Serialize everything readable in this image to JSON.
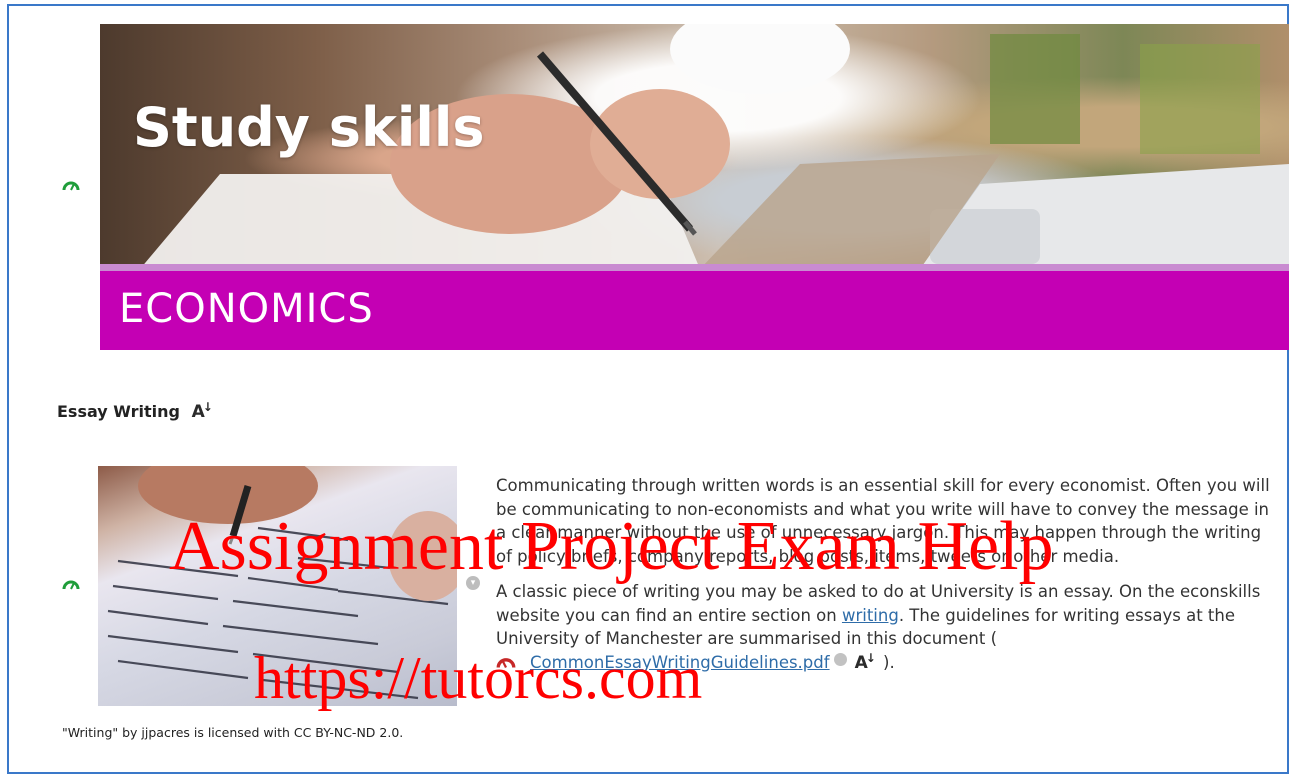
{
  "banner": {
    "title": "Study skills",
    "subtitle": "ECONOMICS"
  },
  "section": {
    "heading": "Essay Writing",
    "accessibility_icon_glyph": "A"
  },
  "image": {
    "caption": "\"Writing\" by jjpacres is licensed with CC BY-NC-ND 2.0."
  },
  "body": {
    "paragraph1": "Communicating through written words is an essential skill for every economist. Often you will be communicating to non-economists and what you write will have to convey the message in a clear manner without the use of unnecessary jargon. This may happen through the writing of policy briefs, company reports, blog posts, items, tweets or other media.",
    "paragraph2_before_link": "A classic piece of writing you may be asked to do at University is an essay. On the econskills website you can find an entire section on ",
    "writing_link": "writing",
    "paragraph2_after_link": ". The guidelines for writing essays at the University of Manchester are summarised in this document (",
    "file_link": "CommonEssayWritingGuidelines.pdf",
    "closing": ")."
  },
  "watermark": {
    "line1": "Assignment Project Exam Help",
    "line2": "https://tutorcs.com"
  },
  "colors": {
    "frame_border": "#3a78c9",
    "banner_strip": "#c400b4",
    "link": "#2e6ca8",
    "gauge_green": "#1f9d3a",
    "gauge_red": "#c62828",
    "watermark": "#ff0000"
  },
  "icons": {
    "status_gauge": "gauge-icon",
    "pdf_status": "gauge-low-icon",
    "options": "chevron-down-icon",
    "alternative_formats": "alternative-formats-icon"
  }
}
